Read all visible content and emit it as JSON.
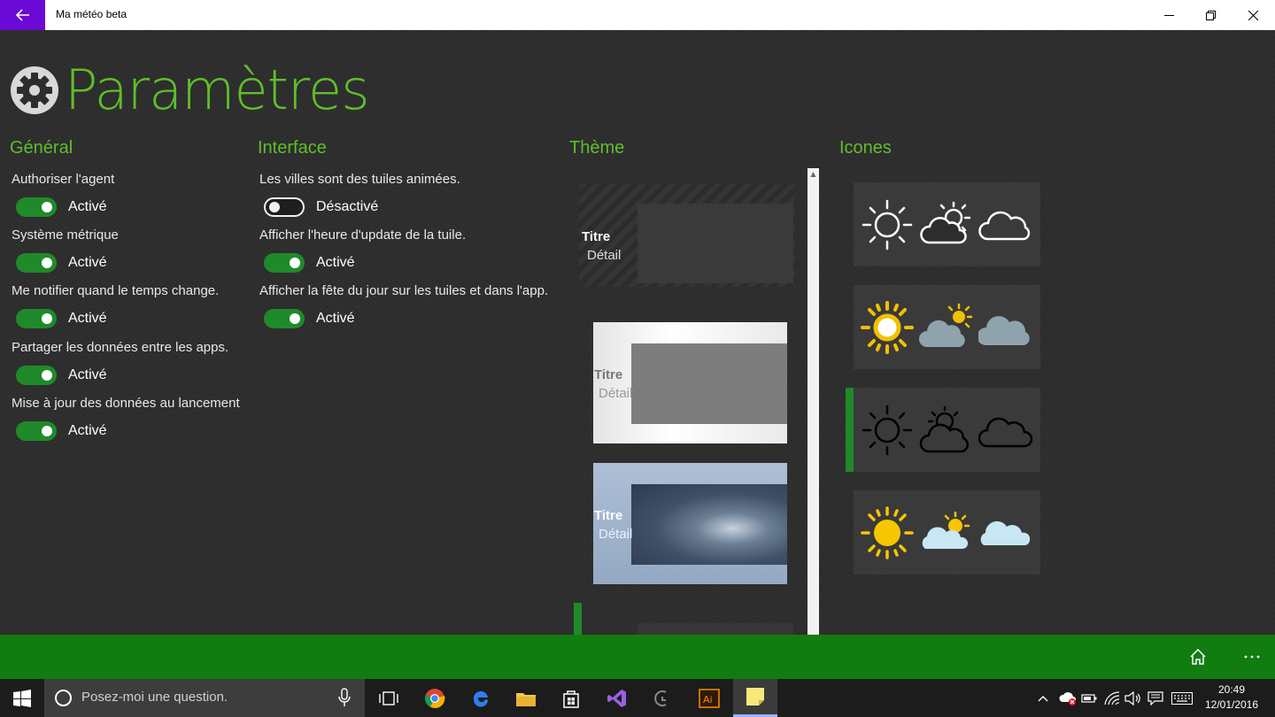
{
  "window": {
    "title": "Ma météo beta"
  },
  "page": {
    "title": "Paramètres"
  },
  "sections": {
    "general": {
      "title": "Général",
      "settings": [
        {
          "label": "Authoriser l'agent",
          "state": "Activé"
        },
        {
          "label": "Système métrique",
          "state": "Activé"
        },
        {
          "label": "Me notifier quand le temps change.",
          "state": "Activé"
        },
        {
          "label": "Partager les données entre les apps.",
          "state": "Activé"
        },
        {
          "label": "Mise à jour des données au lancement",
          "state": "Activé"
        }
      ]
    },
    "interface": {
      "title": "Interface",
      "settings": [
        {
          "label": "Les villes sont des tuiles animées.",
          "state": "Désactivé"
        },
        {
          "label": "Afficher l'heure d'update de la tuile.",
          "state": "Activé"
        },
        {
          "label": "Afficher la fête du jour sur les tuiles et dans l'app.",
          "state": "Activé"
        }
      ]
    },
    "theme": {
      "title": "Thème",
      "items": [
        {
          "title": "Titre",
          "detail": "Détail"
        },
        {
          "title": "Titre",
          "detail": "Détail"
        },
        {
          "title": "Titre",
          "detail": "Détail"
        }
      ]
    },
    "icons": {
      "title": "Icones"
    }
  },
  "taskbar": {
    "search_placeholder": "Posez-moi une question.",
    "time": "20:49",
    "date": "12/01/2016"
  },
  "colors": {
    "accent": "#5fbf2a",
    "appbar": "#117c10",
    "toggle_on": "#1f8a2a",
    "titlebar_back": "#6b0ad6"
  }
}
